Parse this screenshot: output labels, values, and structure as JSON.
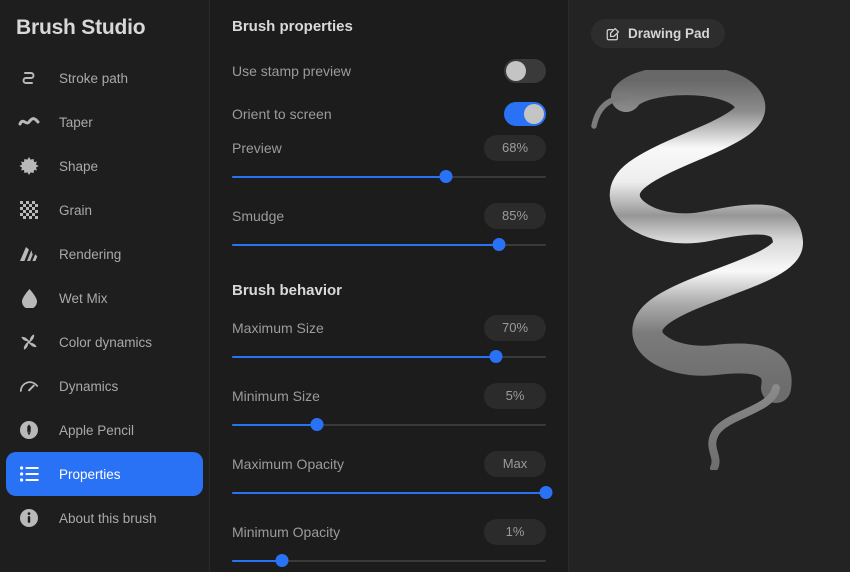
{
  "app": {
    "title": "Brush Studio",
    "accent_color": "#2a72f5",
    "background_color": "#1c1c1c",
    "sidebar_color": "#1e1e1e",
    "right_panel_color": "#232323"
  },
  "sidebar": {
    "items": [
      {
        "label": "Stroke path",
        "icon": "stroke-path-icon",
        "selected": false
      },
      {
        "label": "Taper",
        "icon": "taper-wave-icon",
        "selected": false
      },
      {
        "label": "Shape",
        "icon": "shape-starburst-icon",
        "selected": false
      },
      {
        "label": "Grain",
        "icon": "grain-checker-icon",
        "selected": false
      },
      {
        "label": "Rendering",
        "icon": "rendering-icon",
        "selected": false
      },
      {
        "label": "Wet Mix",
        "icon": "droplet-icon",
        "selected": false
      },
      {
        "label": "Color dynamics",
        "icon": "color-dynamics-icon",
        "selected": false
      },
      {
        "label": "Dynamics",
        "icon": "gauge-icon",
        "selected": false
      },
      {
        "label": "Apple Pencil",
        "icon": "apple-pencil-icon",
        "selected": false
      },
      {
        "label": "Properties",
        "icon": "list-icon",
        "selected": true
      },
      {
        "label": "About this brush",
        "icon": "info-icon",
        "selected": false
      }
    ]
  },
  "brush_properties": {
    "title": "Brush properties",
    "toggles": [
      {
        "label": "Use stamp preview",
        "on": false
      },
      {
        "label": "Orient to screen",
        "on": true
      }
    ],
    "sliders": [
      {
        "label": "Preview",
        "value_text": "68%",
        "percent": 68
      },
      {
        "label": "Smudge",
        "value_text": "85%",
        "percent": 85
      }
    ]
  },
  "brush_behavior": {
    "title": "Brush behavior",
    "sliders": [
      {
        "label": "Maximum Size",
        "value_text": "70%",
        "percent": 84
      },
      {
        "label": "Minimum Size",
        "value_text": "5%",
        "percent": 27
      },
      {
        "label": "Maximum Opacity",
        "value_text": "Max",
        "percent": 100
      },
      {
        "label": "Minimum Opacity",
        "value_text": "1%",
        "percent": 16
      }
    ]
  },
  "preview": {
    "button_label": "Drawing Pad",
    "button_icon": "edit-square-icon",
    "stroke_name": "brush-stroke-preview"
  }
}
